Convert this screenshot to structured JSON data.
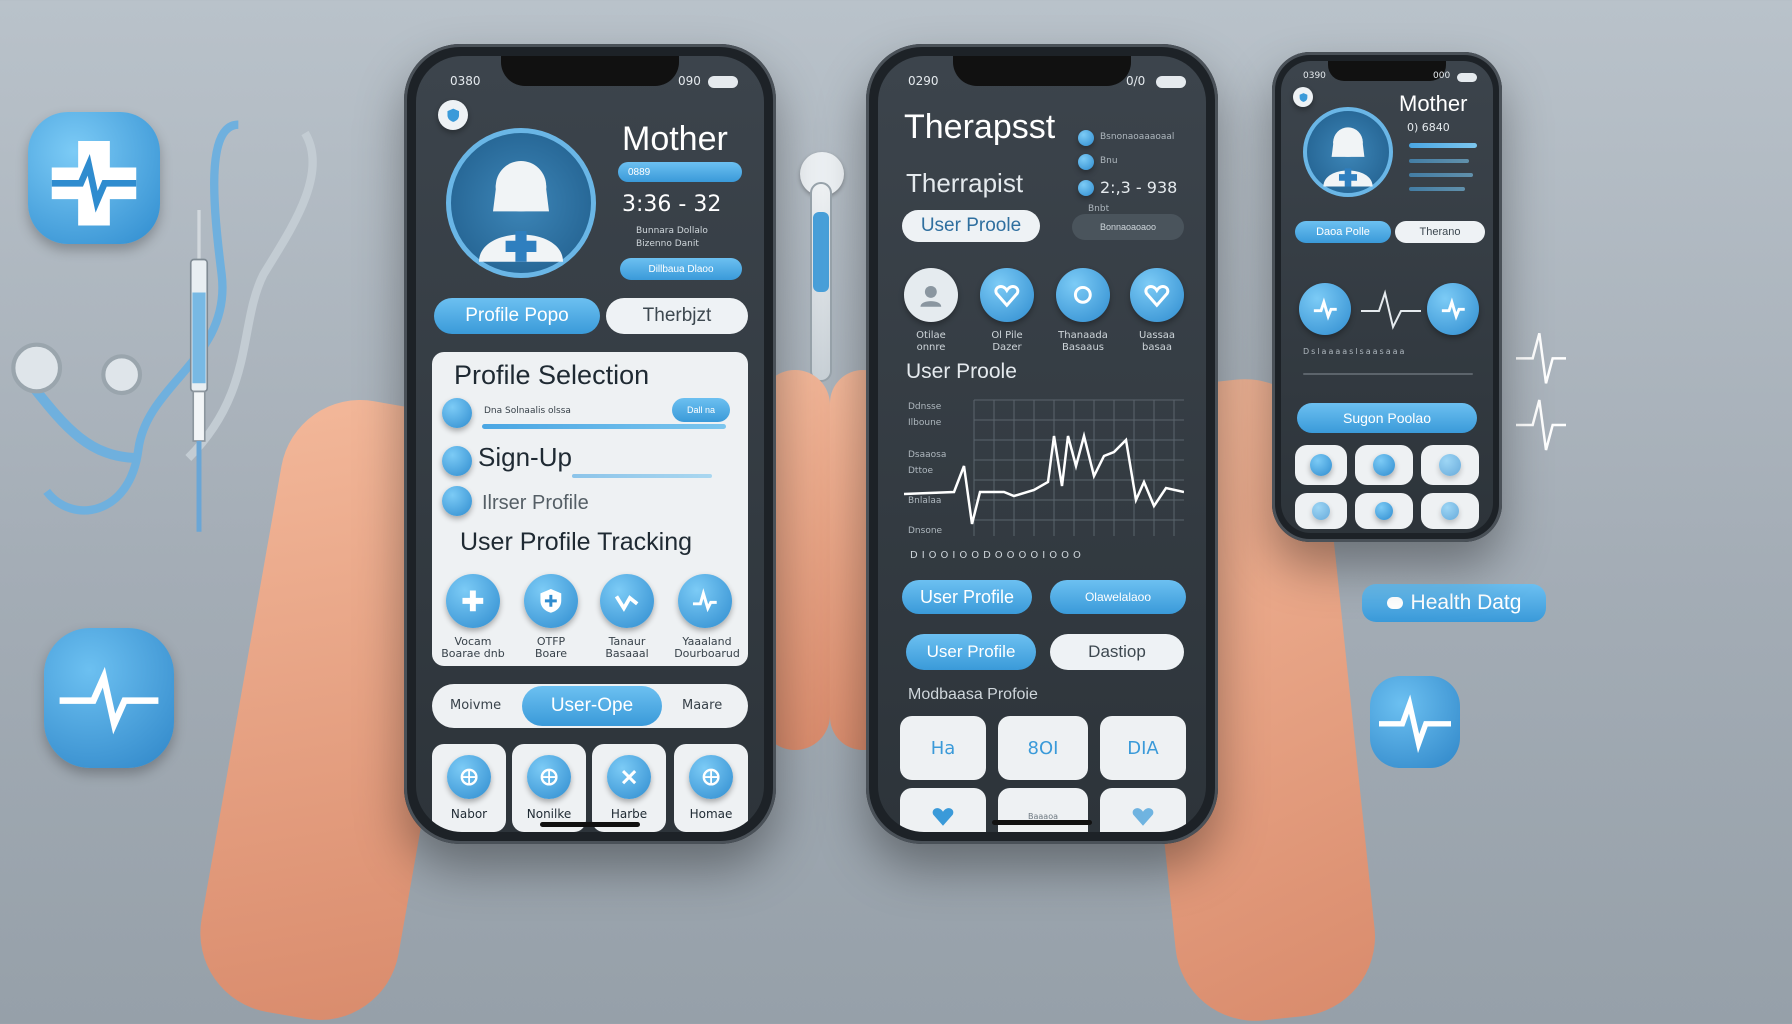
{
  "colors": {
    "accent": "#3a9ad9",
    "accent_light": "#6cc0f1",
    "screen_bg": "#323a41",
    "card_bg": "#eef1f3"
  },
  "decor": {
    "left_top_tile_icon": "cross-ecg-icon",
    "left_bottom_tile_icon": "ecg-icon",
    "stethoscope": "stethoscope-icon",
    "syringe": "syringe-icon",
    "right_chip": "Health Datg"
  },
  "phone1": {
    "status": {
      "time": "0380",
      "right": "090"
    },
    "header_icon": "shield-icon",
    "title": "Mother",
    "info_chip": "0889",
    "time_display": "3:36 - 32",
    "info_line1": "Bunnara Dollalo",
    "info_line2": "Bizenno Danit",
    "info_chip2": "Dillbaua Dlaoo",
    "tabs": [
      "Profile Popo",
      "Therbjzt"
    ],
    "panel": {
      "title": "Profile Selection",
      "row1_text": "Dna Solnaalis olssa",
      "row1_button": "Dall na",
      "row2_text": "Sign-Up",
      "row3_text": "Ilrser Profile",
      "subtitle": "User Profile Tracking",
      "icons": [
        {
          "icon": "cross-icon",
          "label": "Vocam\nBoarae dnb"
        },
        {
          "icon": "shield-cross-icon",
          "label": "OTFP\nBoare"
        },
        {
          "icon": "heart-line-icon",
          "label": "Tanaur\nBasaaal"
        },
        {
          "icon": "ecg-icon",
          "label": "Yaaaland\nDourboarud"
        }
      ]
    },
    "segment": [
      "Moivme",
      "User-Ope",
      "Maare"
    ],
    "grid": [
      {
        "icon": "globe-icon",
        "label": "Nabor"
      },
      {
        "icon": "globe-icon",
        "label": "Nonilke"
      },
      {
        "icon": "cross-icon",
        "label": "Harbe"
      },
      {
        "icon": "globe-icon",
        "label": "Homae"
      }
    ]
  },
  "phone2": {
    "status": {
      "time": "0290",
      "right": "0/0"
    },
    "title": "Therapsst",
    "sub_title": "Therrapist",
    "info_rows": [
      "Bsnonaoaaaoaal",
      "Bnu",
      "2:,3 - 938",
      "Bnbt"
    ],
    "profile_button": "User Proole",
    "right_chip": "Bonnaoaoaoo",
    "avatars": [
      {
        "icon": "avatar-icon",
        "label": "Otilae\nonnre"
      },
      {
        "icon": "heart-icon",
        "label": "Ol Pile\nDazer"
      },
      {
        "icon": "ring-icon",
        "label": "Thanaada\nBasaaus"
      },
      {
        "icon": "heart-icon",
        "label": "Uassaa\nbasaa"
      }
    ],
    "section_title": "User Proole",
    "chart_labels": [
      "Ddnsse",
      "Ilboune",
      "Dsaaosa",
      "Dttoe",
      "Bnlalaa",
      "Dnsone"
    ],
    "chart_axis": "DIOOIOODOOOOIOOO",
    "buttons": [
      "User Profile",
      "Olawelalaoo",
      "User Profile",
      "Dastiop"
    ],
    "list_title": "Modbaasa Profoie",
    "grid": [
      "Ha",
      "8OI",
      "DIA",
      "",
      "Baaaoa",
      ""
    ]
  },
  "phone3": {
    "status": {
      "time": "0390",
      "right": "000"
    },
    "title": "Mother",
    "sub": "0) 6840",
    "tabs": [
      "Daoa Polle",
      "Therano"
    ],
    "chart_caption": "Dslaaaaslsaasaaa",
    "button": "Sugon Poolao"
  }
}
